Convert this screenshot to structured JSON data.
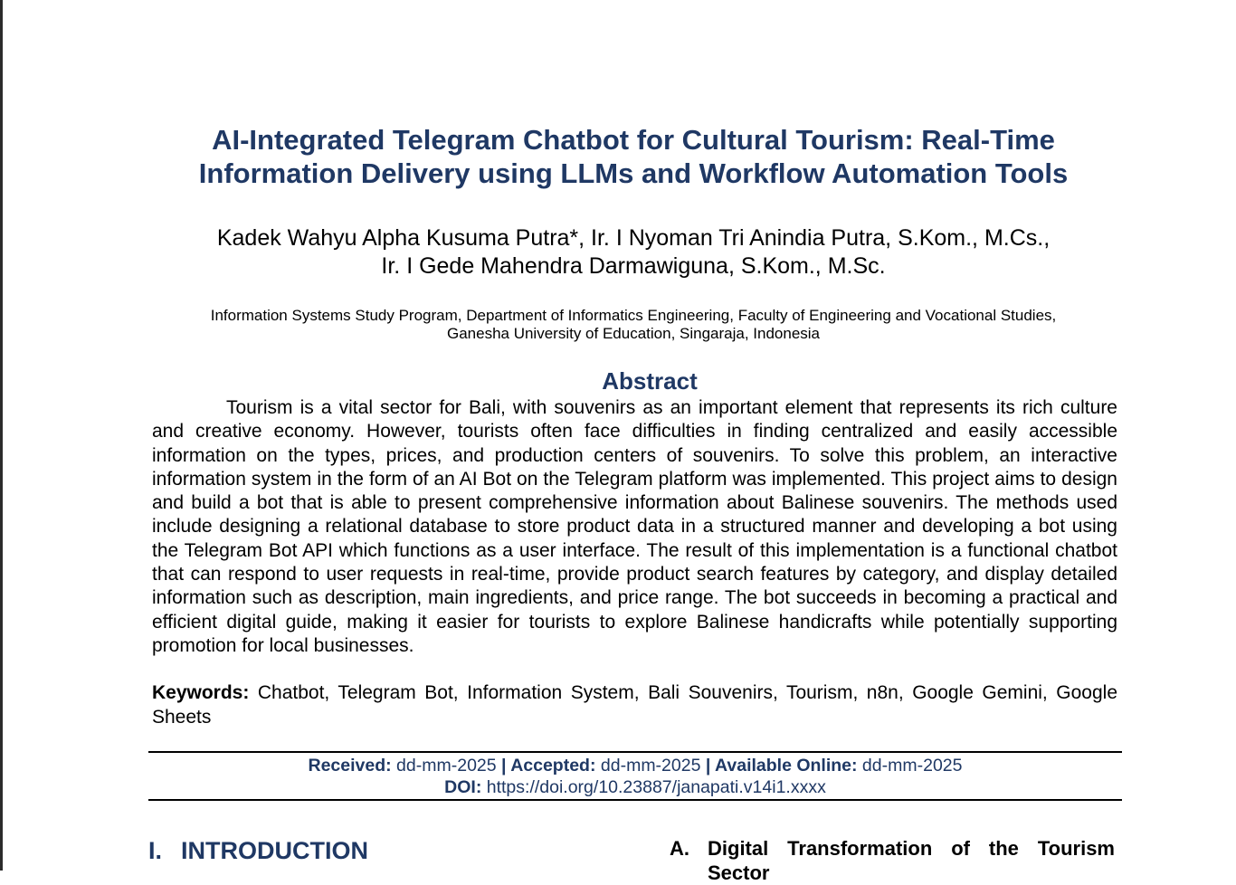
{
  "title": {
    "line1": "AI-Integrated Telegram Chatbot for Cultural Tourism: Real-Time",
    "line2": "Information Delivery using LLMs and Workflow Automation Tools"
  },
  "authors": {
    "line1": "Kadek Wahyu Alpha Kusuma Putra*, Ir. I Nyoman Tri Anindia Putra, S.Kom., M.Cs.,",
    "line2": "Ir. I Gede Mahendra Darmawiguna, S.Kom., M.Sc."
  },
  "affiliation": {
    "line1": "Information Systems Study Program, Department of Informatics Engineering, Faculty of Engineering and Vocational Studies,",
    "line2": "Ganesha University of Education, Singaraja, Indonesia"
  },
  "abstract": {
    "heading": "Abstract",
    "text": "Tourism is a vital sector for Bali, with souvenirs as an important element that represents its rich culture and creative economy. However, tourists often face difficulties in finding centralized and easily accessible information on the types, prices, and production centers of souvenirs. To solve this problem, an interactive information system in the form of an AI Bot on the Telegram platform was implemented. This project aims to design and build a bot that is able to present comprehensive information about Balinese souvenirs. The methods used include designing a relational database to store product data in a structured manner and developing a bot using the Telegram Bot API which functions as a user interface. The result of this implementation is a functional chatbot that can respond to user requests in real-time, provide product search features by category, and display detailed information such as description, main ingredients, and price range. The bot succeeds in becoming a practical and efficient digital guide, making it easier for tourists to explore Balinese handicrafts while potentially supporting promotion for local businesses."
  },
  "keywords": {
    "label": "Keywords:",
    "text": " Chatbot, Telegram Bot, Information System, Bali Souvenirs, Tourism, n8n, Google Gemini, Google Sheets"
  },
  "meta": {
    "received_label": "Received:",
    "received_value": " dd-mm-2025 ",
    "sep": "|",
    "accepted_label": " Accepted:",
    "accepted_value": " dd-mm-2025 ",
    "online_label": " Available Online:",
    "online_value": " dd-mm-2025",
    "doi_label": "DOI:",
    "doi_value": " https://doi.org/10.23887/janapati.v14i1.xxxx"
  },
  "section1": {
    "number": "I.",
    "title": "INTRODUCTION"
  },
  "subsectionA": {
    "number": "A.",
    "title": "Digital Transformation of the Tourism Sector"
  },
  "colors": {
    "heading": "#1f3864",
    "text": "#000000"
  }
}
